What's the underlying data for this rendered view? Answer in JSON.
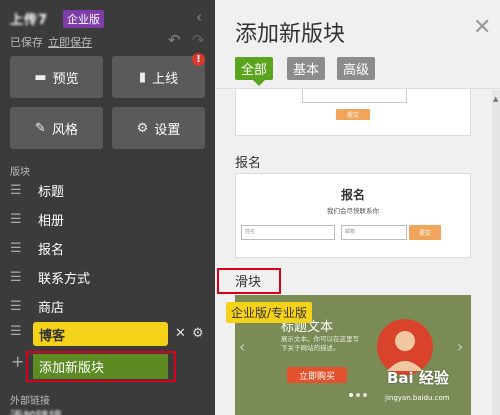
{
  "app": {
    "site_name": "上传7",
    "edition_badge": "企业版",
    "save_status": "已保存",
    "save_now": "立即保存"
  },
  "sidebar": {
    "tiles": [
      {
        "label": "预览",
        "icon": "monitor-icon"
      },
      {
        "label": "上线",
        "icon": "document-icon"
      },
      {
        "label": "风格",
        "icon": "brush-icon"
      },
      {
        "label": "设置",
        "icon": "gear-icon"
      }
    ],
    "notice_badge": "!",
    "sections_title": "版块",
    "sections": [
      {
        "label": "标题"
      },
      {
        "label": "相册"
      },
      {
        "label": "报名"
      },
      {
        "label": "联系方式"
      },
      {
        "label": "商店"
      }
    ],
    "active_section": "博客",
    "add_section_label": "添加新版块",
    "external_links_title": "外部链接",
    "external_item": "添加链接"
  },
  "panel": {
    "title": "添加新版块",
    "tabs": [
      {
        "label": "全部",
        "active": true
      },
      {
        "label": "基本",
        "active": false
      },
      {
        "label": "高级",
        "active": false
      }
    ],
    "top_card_button": "提交",
    "signup_label": "报名",
    "signup_card": {
      "title": "报名",
      "subtitle": "我们会尽快联系你",
      "name_placeholder": "姓名",
      "email_placeholder": "邮箱",
      "button": "提交"
    },
    "slider_label": "滑块",
    "slider_tier_badge": "企业版/专业版",
    "slider_card": {
      "title": "标题文本",
      "body": "展示文本。你可以在这里写下关于网站的描述。",
      "button": "立即购买"
    },
    "watermark": "Bai 经验",
    "watermark_url": "jingyan.baidu.com"
  },
  "colors": {
    "sidebar_bg": "#3b3b3b",
    "accent_green": "#5aa41e",
    "edition_purple": "#7d3da8",
    "highlight_yellow": "#f5d21a",
    "annotation_red": "#d9001b"
  }
}
